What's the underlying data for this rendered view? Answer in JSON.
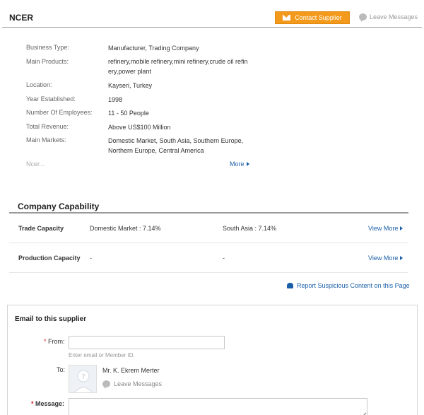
{
  "header": {
    "title": "NCER",
    "contact_label": "Contact Supplier",
    "leave_messages": "Leave Messages"
  },
  "details": {
    "rows": [
      {
        "label": "Business Type:",
        "value": "Manufacturer, Trading Company"
      },
      {
        "label": "Main Products:",
        "value": "refinery,mobile refinery,mini refinery,crude oil refin ery,power plant"
      },
      {
        "label": "Location:",
        "value": "Kayseri, Turkey"
      },
      {
        "label": "Year Established:",
        "value": "1998"
      },
      {
        "label": "Number Of Employees:",
        "value": "11 - 50 People"
      },
      {
        "label": "Total Revenue:",
        "value": "Above US$100 Million"
      },
      {
        "label": "Main Markets:",
        "value": "Domestic Market, South Asia, Southern Europe, Northern Europe, Central America"
      }
    ],
    "more_text": "Ncer...",
    "more_link": "More"
  },
  "capability": {
    "title": "Company Capability",
    "rows": [
      {
        "label": "Trade Capacity",
        "v1": "Domestic Market : 7.14%",
        "v2": "South Asia : 7.14%",
        "more": "View More"
      },
      {
        "label": "Production Capacity",
        "v1": "-",
        "v2": "-",
        "more": "View More"
      }
    ],
    "report": "Report Suspicious Content on this Page"
  },
  "email": {
    "title": "Email to this supplier",
    "from_label": "From:",
    "from_placeholder": "",
    "from_hint": "Enter email or Member ID.",
    "to_label": "To:",
    "to_name": "Mr. K. Ekrem Merter",
    "leave_messages": "Leave Messages",
    "message_label": "Message:",
    "required_mark": "*"
  },
  "colors": {
    "accent": "#f39a1c",
    "link": "#1a5fa8",
    "required": "#e02020"
  }
}
